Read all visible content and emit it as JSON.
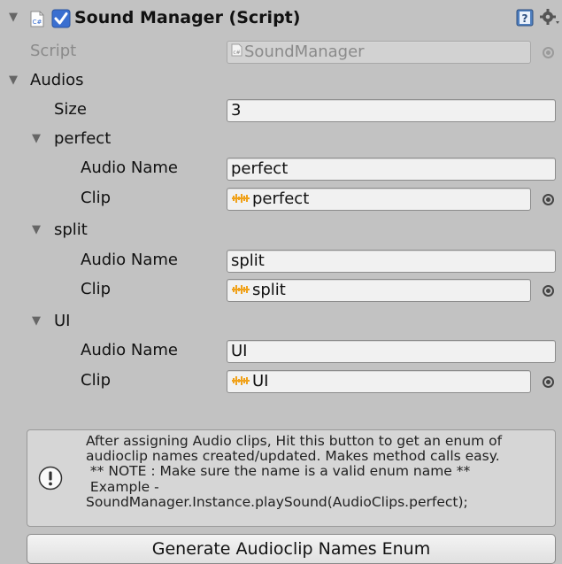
{
  "component": {
    "title": "Sound Manager (Script)",
    "enabled": true
  },
  "script_field": {
    "label": "Script",
    "value": "SoundManager"
  },
  "audios": {
    "label": "Audios",
    "size_label": "Size",
    "size_value": "3",
    "elements": [
      {
        "foldout": "perfect",
        "name_label": "Audio Name",
        "name_value": "perfect",
        "clip_label": "Clip",
        "clip_value": "perfect"
      },
      {
        "foldout": "split",
        "name_label": "Audio Name",
        "name_value": "split",
        "clip_label": "Clip",
        "clip_value": "split"
      },
      {
        "foldout": "UI",
        "name_label": "Audio Name",
        "name_value": "UI",
        "clip_label": "Clip",
        "clip_value": "UI"
      }
    ]
  },
  "help": {
    "lines": [
      "After assigning Audio clips, Hit this button to get an enum of",
      "audioclip names created/updated. Makes method calls easy.",
      " ** NOTE : Make sure the name is a valid enum name **",
      " Example -",
      "SoundManager.Instance.playSound(AudioClips.perfect);"
    ]
  },
  "generate_button": {
    "label": "Generate Audioclip Names Enum"
  },
  "colors": {
    "background": "#c2c2c2",
    "field": "#f1f1f1",
    "checkbox_blue": "#3a6fd0",
    "audio_icon": "#f0a21b"
  }
}
